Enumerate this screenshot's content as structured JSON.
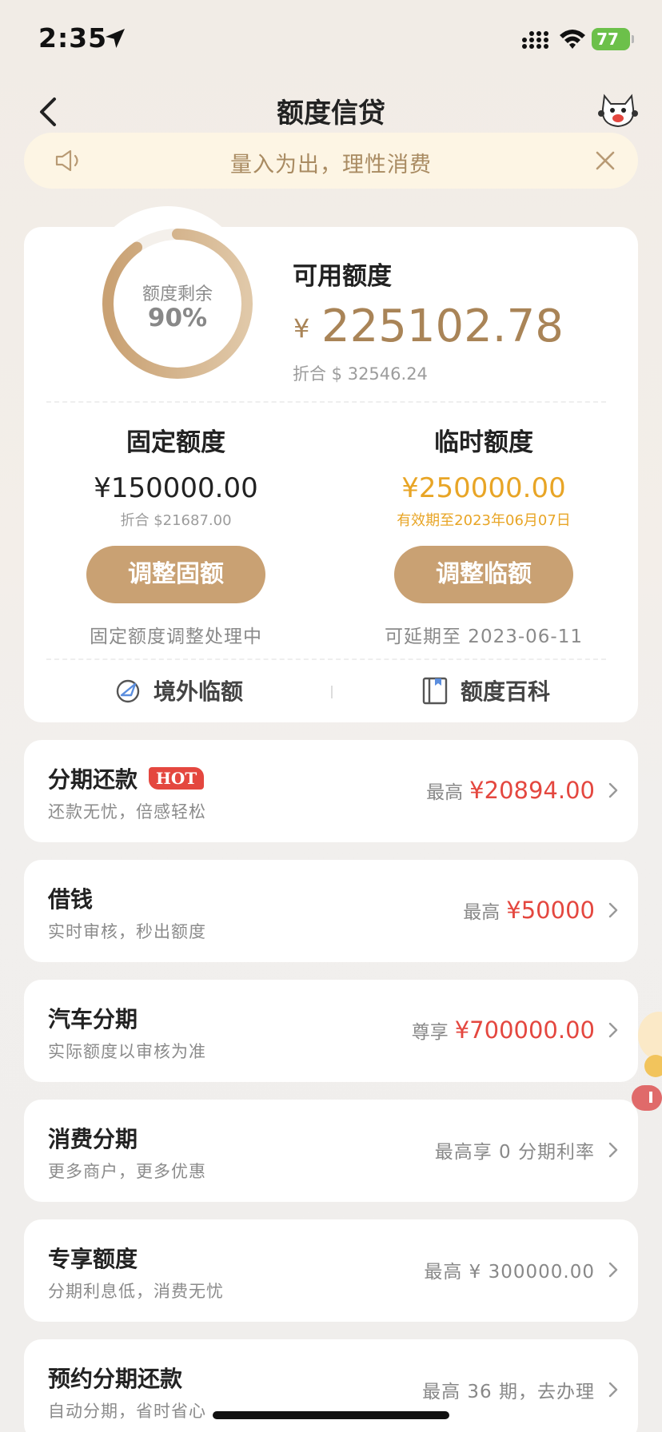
{
  "status_bar": {
    "time": "2:35",
    "battery": "77"
  },
  "nav": {
    "title": "额度信贷"
  },
  "notice": {
    "text": "量入为出，理性消费"
  },
  "quota": {
    "ring_label": "额度剩余",
    "ring_percent_text": "90%",
    "ring_fraction": 0.9,
    "available_title": "可用额度",
    "available_currency": "¥",
    "available_amount": "225102.78",
    "available_converted": "折合 $ 32546.24",
    "fixed": {
      "title": "固定额度",
      "amount": "¥150000.00",
      "sub": "折合 $21687.00",
      "button": "调整固额",
      "note": "固定额度调整处理中"
    },
    "temporary": {
      "title": "临时额度",
      "amount": "¥250000.00",
      "sub": "有效期至2023年06月07日",
      "button": "调整临额",
      "note": "可延期至 2023-06-11"
    },
    "links": {
      "overseas": "境外临额",
      "encyclopedia": "额度百科"
    }
  },
  "products": [
    {
      "title": "分期还款",
      "badge": "HOT",
      "sub": "还款无忧，倍感轻松",
      "prefix": "最高",
      "value": "¥20894.00"
    },
    {
      "title": "借钱",
      "sub": "实时审核，秒出额度",
      "prefix": "最高",
      "value": "¥50000"
    },
    {
      "title": "汽车分期",
      "sub": "实际额度以审核为准",
      "prefix": "尊享",
      "value": "¥700000.00"
    },
    {
      "title": "消费分期",
      "sub": "更多商户，更多优惠",
      "plain": "最高享 0 分期利率"
    },
    {
      "title": "专享额度",
      "sub": "分期利息低，消费无忧",
      "plain": "最高 ¥ 300000.00"
    },
    {
      "title": "预约分期还款",
      "sub": "自动分期，省时省心",
      "plain": "最高 36 期，去办理"
    }
  ],
  "colors": {
    "gold": "#c9a173",
    "orange": "#e8a526",
    "red": "#e4473f",
    "accent_text": "#a98457"
  }
}
